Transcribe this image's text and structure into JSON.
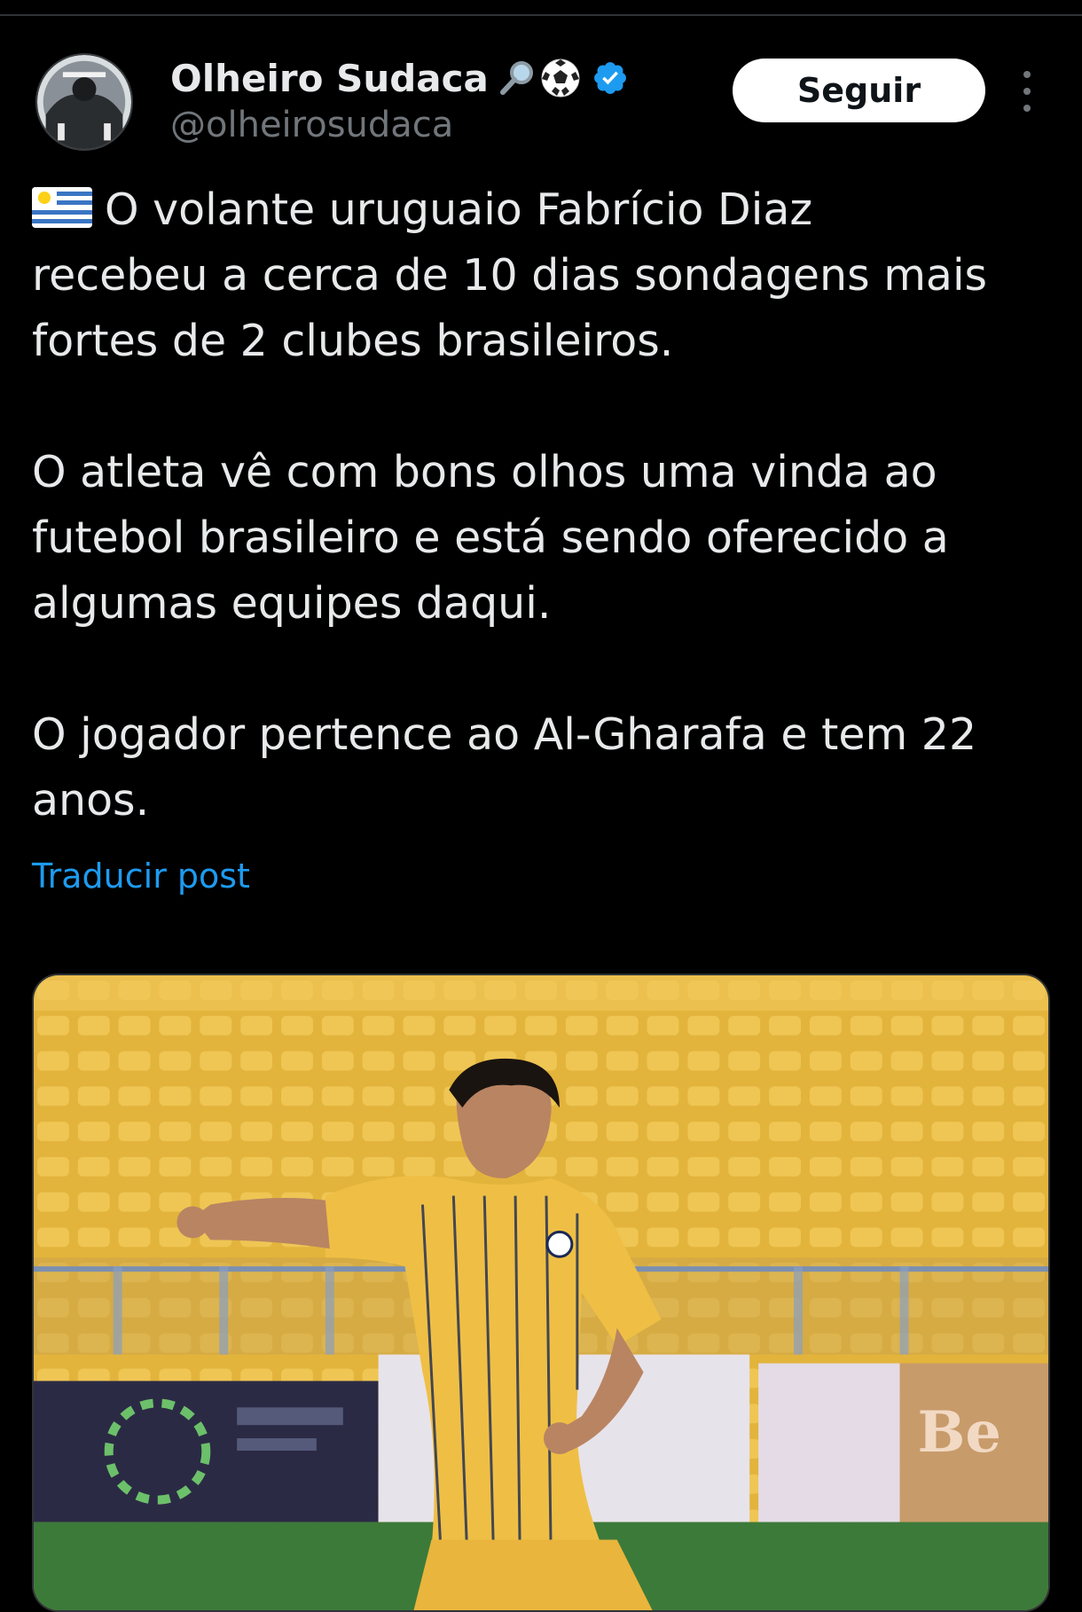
{
  "author": {
    "display_name": "Olheiro Sudaca",
    "handle": "@olheirosudaca",
    "name_emojis": [
      "magnifying-glass-icon",
      "soccer-ball-icon"
    ],
    "verified": true
  },
  "follow_button": {
    "label": "Seguir"
  },
  "tweet": {
    "paragraphs": [
      "O volante uruguaio Fabrício Diaz\nrecebeu a cerca de 10 dias sondagens mais\nfortes de 2 clubes brasileiros.",
      "O atleta vê com bons olhos uma vinda ao\nfutebol brasileiro e está sendo oferecido a\nalgumas equipes daqui.",
      "O jogador pertence ao Al-Gharafa e tem 22\nanos."
    ],
    "flag": "uruguay-flag-icon"
  },
  "translate": {
    "label": "Traducir post"
  },
  "media": {
    "banner_text": "Be",
    "colors": {
      "stands": "#e8b83a",
      "jersey": "#efbf45",
      "pitch": "#3c7a3a"
    }
  },
  "colors": {
    "background": "#000000",
    "link": "#1d9bf0",
    "verified": "#1d9bf0",
    "muted": "#71767b"
  }
}
